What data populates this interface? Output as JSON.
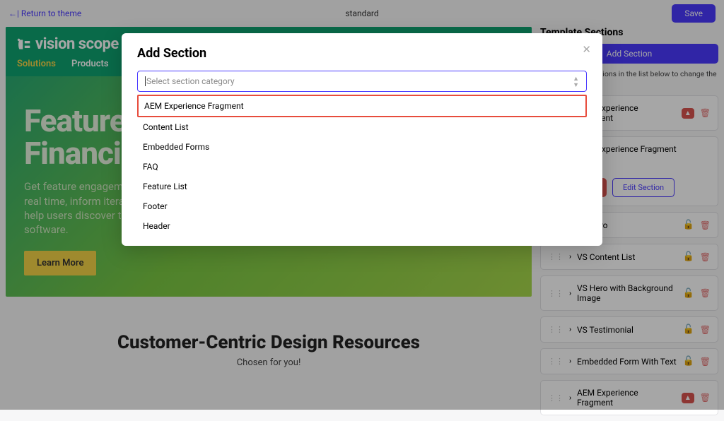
{
  "topbar": {
    "return_link": "←| Return to theme",
    "title": "standard",
    "save": "Save"
  },
  "preview": {
    "brand": "vision scope",
    "nav": {
      "active": "Solutions",
      "item2": "Products"
    },
    "hero_title_line1": "FeatureS",
    "hero_title_line2": "Financia",
    "hero_sub": "Get feature engagement and adoption stats in real time, inform iteration with real usage data, help users discover the real value of your software.",
    "cta": "Learn More",
    "section2_title": "Customer-Centric Design Resources",
    "section2_sub": "Chosen for you!"
  },
  "sidebar": {
    "title": "Template Sections",
    "add_btn": "Add Section",
    "help": "Drag and drop sections in the list below to change the order",
    "delete_btn": "Delete",
    "edit_btn": "Edit Section",
    "items": [
      {
        "name": "AEM Experience Fragment",
        "warn": true
      },
      {
        "name": "AEM Experience Fragment",
        "expanded": true
      },
      {
        "name": "VS Hero"
      },
      {
        "name": "VS Content List"
      },
      {
        "name": "VS Hero with Background Image"
      },
      {
        "name": "VS Testimonial"
      },
      {
        "name": "Embedded Form With Text"
      },
      {
        "name": "AEM Experience Fragment",
        "warn": true
      }
    ]
  },
  "modal": {
    "title": "Add Section",
    "placeholder": "Select section category",
    "options": [
      "AEM Experience Fragment",
      "Content List",
      "Embedded Forms",
      "FAQ",
      "Feature List",
      "Footer",
      "Header"
    ]
  }
}
